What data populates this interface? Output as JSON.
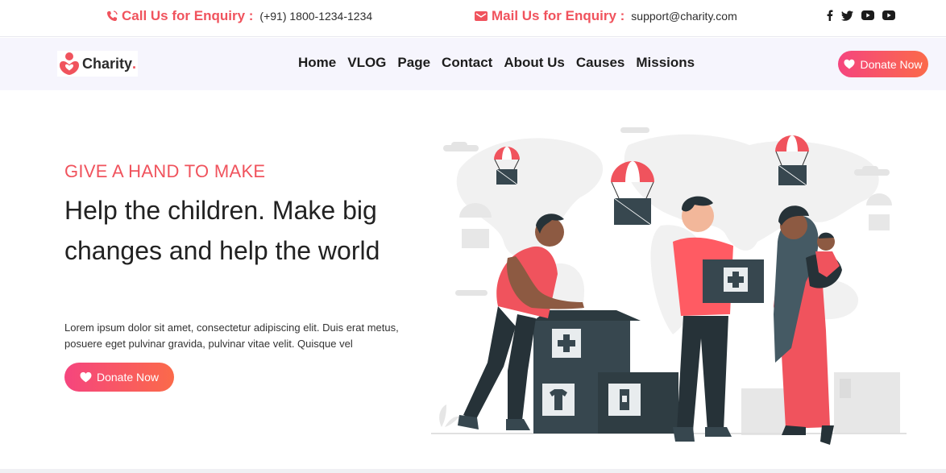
{
  "topbar": {
    "call_label": "Call Us for Enquiry :",
    "call_value": "(+91) 1800-1234-1234",
    "mail_label": "Mail Us for Enquiry :",
    "mail_value": "support@charity.com",
    "social_icons": [
      "facebook-icon",
      "twitter-icon",
      "youtube-icon",
      "youtube-icon"
    ]
  },
  "nav": {
    "logo_text": "Charity",
    "logo_dot": ".",
    "items": [
      "Home",
      "VLOG",
      "Page",
      "Contact",
      "About Us",
      "Causes",
      "Missions"
    ],
    "donate_label": "Donate Now"
  },
  "hero": {
    "subtitle": "GIVE A HAND TO MAKE",
    "title": "Help the children. Make big changes and help the world",
    "text": "Lorem ipsum dolor sit amet, consectetur adipiscing elit. Duis erat metus, posuere eget pulvinar gravida, pulvinar vitae velit. Quisque vel",
    "donate_label": "Donate Now"
  },
  "colors": {
    "accent": "#f0535d",
    "gradient_start": "#f5457e",
    "gradient_end": "#fb6a4a",
    "nav_bg": "#f6f5fd"
  }
}
